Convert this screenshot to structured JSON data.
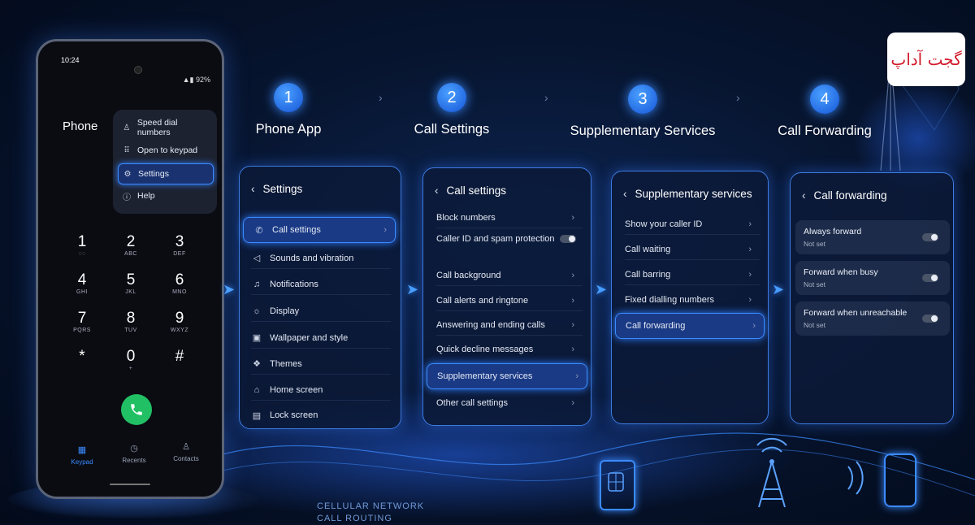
{
  "phone": {
    "time": "10:24",
    "status_right": "▲▮ 92%",
    "title": "Phone",
    "menu": [
      {
        "icon": "person-icon",
        "glyph": "♙",
        "label": "Speed dial numbers"
      },
      {
        "icon": "grid-icon",
        "glyph": "⠿",
        "label": "Open to keypad"
      },
      {
        "icon": "gear-icon",
        "glyph": "⚙",
        "label": "Settings",
        "selected": true
      },
      {
        "icon": "help-icon",
        "glyph": "ⓘ",
        "label": "Help"
      }
    ],
    "keys": [
      {
        "d": "1",
        "l": "◌◌"
      },
      {
        "d": "2",
        "l": "ABC"
      },
      {
        "d": "3",
        "l": "DEF"
      },
      {
        "d": "4",
        "l": "GHI"
      },
      {
        "d": "5",
        "l": "JKL"
      },
      {
        "d": "6",
        "l": "MNO"
      },
      {
        "d": "7",
        "l": "PQRS"
      },
      {
        "d": "8",
        "l": "TUV"
      },
      {
        "d": "9",
        "l": "WXYZ"
      },
      {
        "d": "*",
        "l": ""
      },
      {
        "d": "0",
        "l": "+"
      },
      {
        "d": "#",
        "l": ""
      }
    ],
    "tabs": [
      {
        "glyph": "▦",
        "label": "Keypad",
        "active": true
      },
      {
        "glyph": "◷",
        "label": "Recents"
      },
      {
        "glyph": "♙",
        "label": "Contacts"
      }
    ]
  },
  "steps": [
    {
      "num": "1",
      "title": "Phone App"
    },
    {
      "num": "2",
      "title": "Call Settings"
    },
    {
      "num": "3",
      "title": "Supplementary Services"
    },
    {
      "num": "4",
      "title": "Call Forwarding"
    }
  ],
  "panel1": {
    "title": "Settings",
    "items": [
      {
        "icon": "phone-icon",
        "glyph": "✆",
        "label": "Call settings",
        "selected": true
      },
      {
        "icon": "speaker-icon",
        "glyph": "◁",
        "label": "Sounds and vibration"
      },
      {
        "icon": "bell-icon",
        "glyph": "♫",
        "label": "Notifications"
      },
      {
        "icon": "sun-icon",
        "glyph": "☼",
        "label": "Display"
      },
      {
        "icon": "image-icon",
        "glyph": "▣",
        "label": "Wallpaper and style"
      },
      {
        "icon": "palette-icon",
        "glyph": "❖",
        "label": "Themes"
      },
      {
        "icon": "home-icon",
        "glyph": "⌂",
        "label": "Home screen"
      },
      {
        "icon": "lock-icon",
        "glyph": "▤",
        "label": "Lock screen"
      }
    ]
  },
  "panel2": {
    "title": "Call settings",
    "items": [
      {
        "label": "Block numbers",
        "type": "arrow"
      },
      {
        "label": "Caller ID and spam protection",
        "type": "toggle"
      },
      {
        "label": "Call background",
        "type": "arrow"
      },
      {
        "label": "Call alerts and ringtone",
        "type": "arrow"
      },
      {
        "label": "Answering and ending calls",
        "type": "arrow"
      },
      {
        "label": "Quick decline messages",
        "type": "arrow"
      },
      {
        "label": "Supplementary services",
        "type": "arrow",
        "selected": true
      },
      {
        "label": "Other call settings",
        "type": "arrow"
      }
    ]
  },
  "panel3": {
    "title": "Supplementary services",
    "items": [
      {
        "label": "Show your caller ID"
      },
      {
        "label": "Call waiting"
      },
      {
        "label": "Call barring"
      },
      {
        "label": "Fixed dialling numbers"
      },
      {
        "label": "Call forwarding",
        "selected": true
      }
    ]
  },
  "panel4": {
    "title": "Call forwarding",
    "items": [
      {
        "label": "Always forward",
        "sub": "Not set"
      },
      {
        "label": "Forward when busy",
        "sub": "Not set"
      },
      {
        "label": "Forward when unreachable",
        "sub": "Not set"
      }
    ]
  },
  "footer": {
    "line1": "CELLULAR NETWORK",
    "line2": "CALL ROUTING"
  },
  "logo_text": "گجت آداپ",
  "colors": {
    "accent": "#3b8bff",
    "call_green": "#21c064"
  }
}
